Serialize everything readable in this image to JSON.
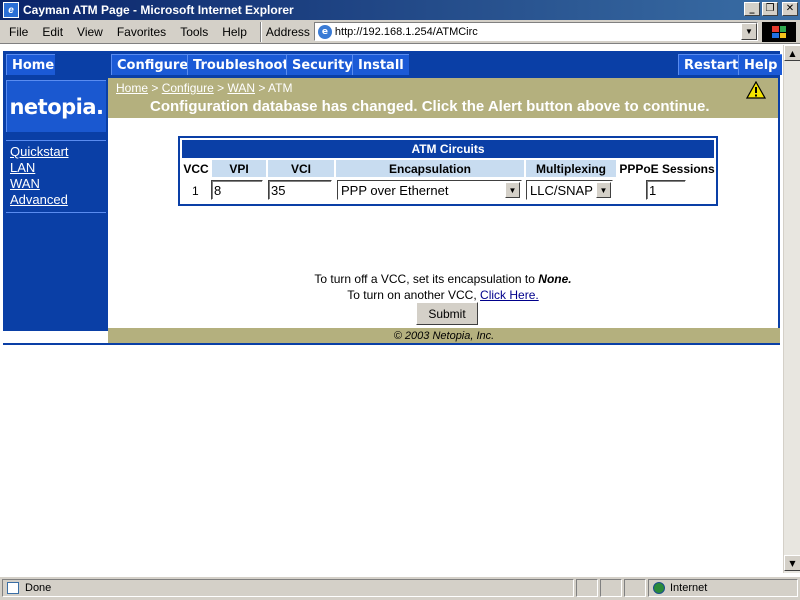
{
  "window": {
    "title": "Cayman ATM Page - Microsoft Internet Explorer",
    "btn_min": "_",
    "btn_max": "❐",
    "btn_close": "✕"
  },
  "menu": {
    "items": [
      "File",
      "Edit",
      "View",
      "Favorites",
      "Tools",
      "Help"
    ]
  },
  "address": {
    "label": "Address",
    "url": "http://192.168.1.254/ATMCirc"
  },
  "nav": {
    "home": "Home",
    "configure": "Configure",
    "troubleshoot": "Troubleshoot",
    "security": "Security",
    "install": "Install",
    "restart": "Restart",
    "help": "Help"
  },
  "sidebar": {
    "logo": "netopia.",
    "links": [
      "Quickstart",
      "LAN",
      "WAN",
      "Advanced"
    ]
  },
  "breadcrumb": {
    "home": "Home",
    "configure": "Configure",
    "wan": "WAN",
    "current": "ATM",
    "sep": ">"
  },
  "alert": {
    "message": "Configuration database has changed. Click the Alert button above to continue."
  },
  "atm": {
    "title": "ATM Circuits",
    "headers": {
      "vcc": "VCC",
      "vpi": "VPI",
      "vci": "VCI",
      "encapsulation": "Encapsulation",
      "multiplexing": "Multiplexing",
      "pppoe": "PPPoE Sessions"
    },
    "row": {
      "vcc": "1",
      "vpi": "8",
      "vci": "35",
      "encapsulation": "PPP over Ethernet",
      "multiplexing": "LLC/SNAP",
      "pppoe": "1"
    }
  },
  "hints": {
    "line1_prefix": "To turn off a VCC, set its encapsulation to ",
    "line1_value": "None.",
    "line2_prefix": "To turn on another VCC, ",
    "line2_link": "Click Here."
  },
  "submit": "Submit",
  "footer": "© 2003 Netopia, Inc.",
  "status": {
    "text": "Done",
    "zone": "Internet"
  }
}
